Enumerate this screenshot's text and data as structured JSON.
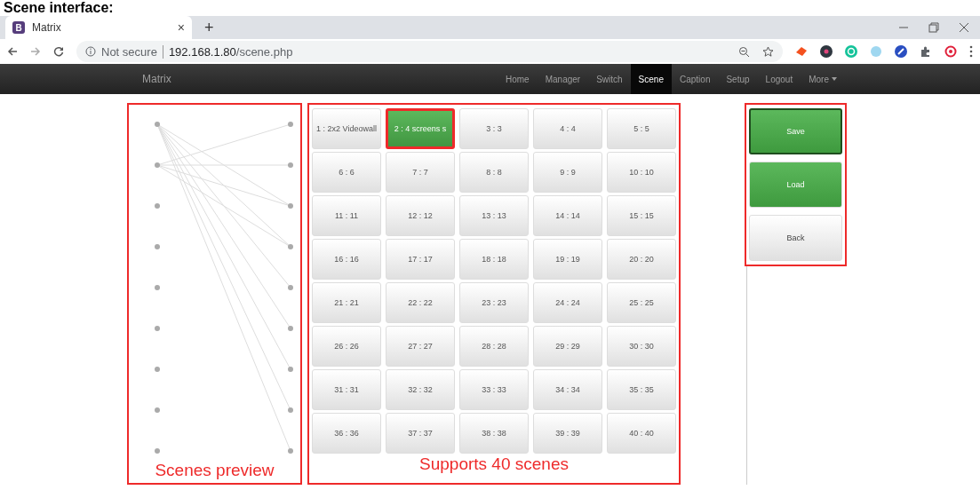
{
  "heading": "Scene interface:",
  "browser": {
    "tab_title": "Matrix",
    "tab_icon_letter": "B",
    "tab_close": "×",
    "new_tab": "+",
    "security": "Not secure",
    "url_host": "192.168.1.80",
    "url_path": "/scene.php"
  },
  "navbar": {
    "brand": "Matrix",
    "items": [
      {
        "label": "Home",
        "selected": false
      },
      {
        "label": "Manager",
        "selected": false
      },
      {
        "label": "Switch",
        "selected": false
      },
      {
        "label": "Scene",
        "selected": true
      },
      {
        "label": "Caption",
        "selected": false
      },
      {
        "label": "Setup",
        "selected": false
      },
      {
        "label": "Logout",
        "selected": false
      },
      {
        "label": "More",
        "selected": false,
        "dropdown": true
      }
    ]
  },
  "preview": {
    "annotation": "Scenes preview"
  },
  "scenes": {
    "annotation": "Supports 40 scenes",
    "items": [
      {
        "label": "1 : 2x2 Videowall",
        "selected": false,
        "annotated": false
      },
      {
        "label": "2 : 4 screens s",
        "selected": true,
        "annotated": true
      },
      {
        "label": "3 : 3",
        "selected": false,
        "annotated": false
      },
      {
        "label": "4 : 4",
        "selected": false,
        "annotated": false
      },
      {
        "label": "5 : 5",
        "selected": false,
        "annotated": false
      },
      {
        "label": "6 : 6",
        "selected": false,
        "annotated": false
      },
      {
        "label": "7 : 7",
        "selected": false,
        "annotated": false
      },
      {
        "label": "8 : 8",
        "selected": false,
        "annotated": false
      },
      {
        "label": "9 : 9",
        "selected": false,
        "annotated": false
      },
      {
        "label": "10 : 10",
        "selected": false,
        "annotated": false
      },
      {
        "label": "11 : 11",
        "selected": false,
        "annotated": false
      },
      {
        "label": "12 : 12",
        "selected": false,
        "annotated": false
      },
      {
        "label": "13 : 13",
        "selected": false,
        "annotated": false
      },
      {
        "label": "14 : 14",
        "selected": false,
        "annotated": false
      },
      {
        "label": "15 : 15",
        "selected": false,
        "annotated": false
      },
      {
        "label": "16 : 16",
        "selected": false,
        "annotated": false
      },
      {
        "label": "17 : 17",
        "selected": false,
        "annotated": false
      },
      {
        "label": "18 : 18",
        "selected": false,
        "annotated": false
      },
      {
        "label": "19 : 19",
        "selected": false,
        "annotated": false
      },
      {
        "label": "20 : 20",
        "selected": false,
        "annotated": false
      },
      {
        "label": "21 : 21",
        "selected": false,
        "annotated": false
      },
      {
        "label": "22 : 22",
        "selected": false,
        "annotated": false
      },
      {
        "label": "23 : 23",
        "selected": false,
        "annotated": false
      },
      {
        "label": "24 : 24",
        "selected": false,
        "annotated": false
      },
      {
        "label": "25 : 25",
        "selected": false,
        "annotated": false
      },
      {
        "label": "26 : 26",
        "selected": false,
        "annotated": false
      },
      {
        "label": "27 : 27",
        "selected": false,
        "annotated": false
      },
      {
        "label": "28 : 28",
        "selected": false,
        "annotated": false
      },
      {
        "label": "29 : 29",
        "selected": false,
        "annotated": false
      },
      {
        "label": "30 : 30",
        "selected": false,
        "annotated": false
      },
      {
        "label": "31 : 31",
        "selected": false,
        "annotated": false
      },
      {
        "label": "32 : 32",
        "selected": false,
        "annotated": false
      },
      {
        "label": "33 : 33",
        "selected": false,
        "annotated": false
      },
      {
        "label": "34 : 34",
        "selected": false,
        "annotated": false
      },
      {
        "label": "35 : 35",
        "selected": false,
        "annotated": false
      },
      {
        "label": "36 : 36",
        "selected": false,
        "annotated": false
      },
      {
        "label": "37 : 37",
        "selected": false,
        "annotated": false
      },
      {
        "label": "38 : 38",
        "selected": false,
        "annotated": false
      },
      {
        "label": "39 : 39",
        "selected": false,
        "annotated": false
      },
      {
        "label": "40 : 40",
        "selected": false,
        "annotated": false
      }
    ]
  },
  "actions": [
    {
      "label": "Save",
      "kind": "primary",
      "focused": true
    },
    {
      "label": "Load",
      "kind": "primary",
      "focused": false
    },
    {
      "label": "Back",
      "kind": "default",
      "focused": false
    }
  ]
}
